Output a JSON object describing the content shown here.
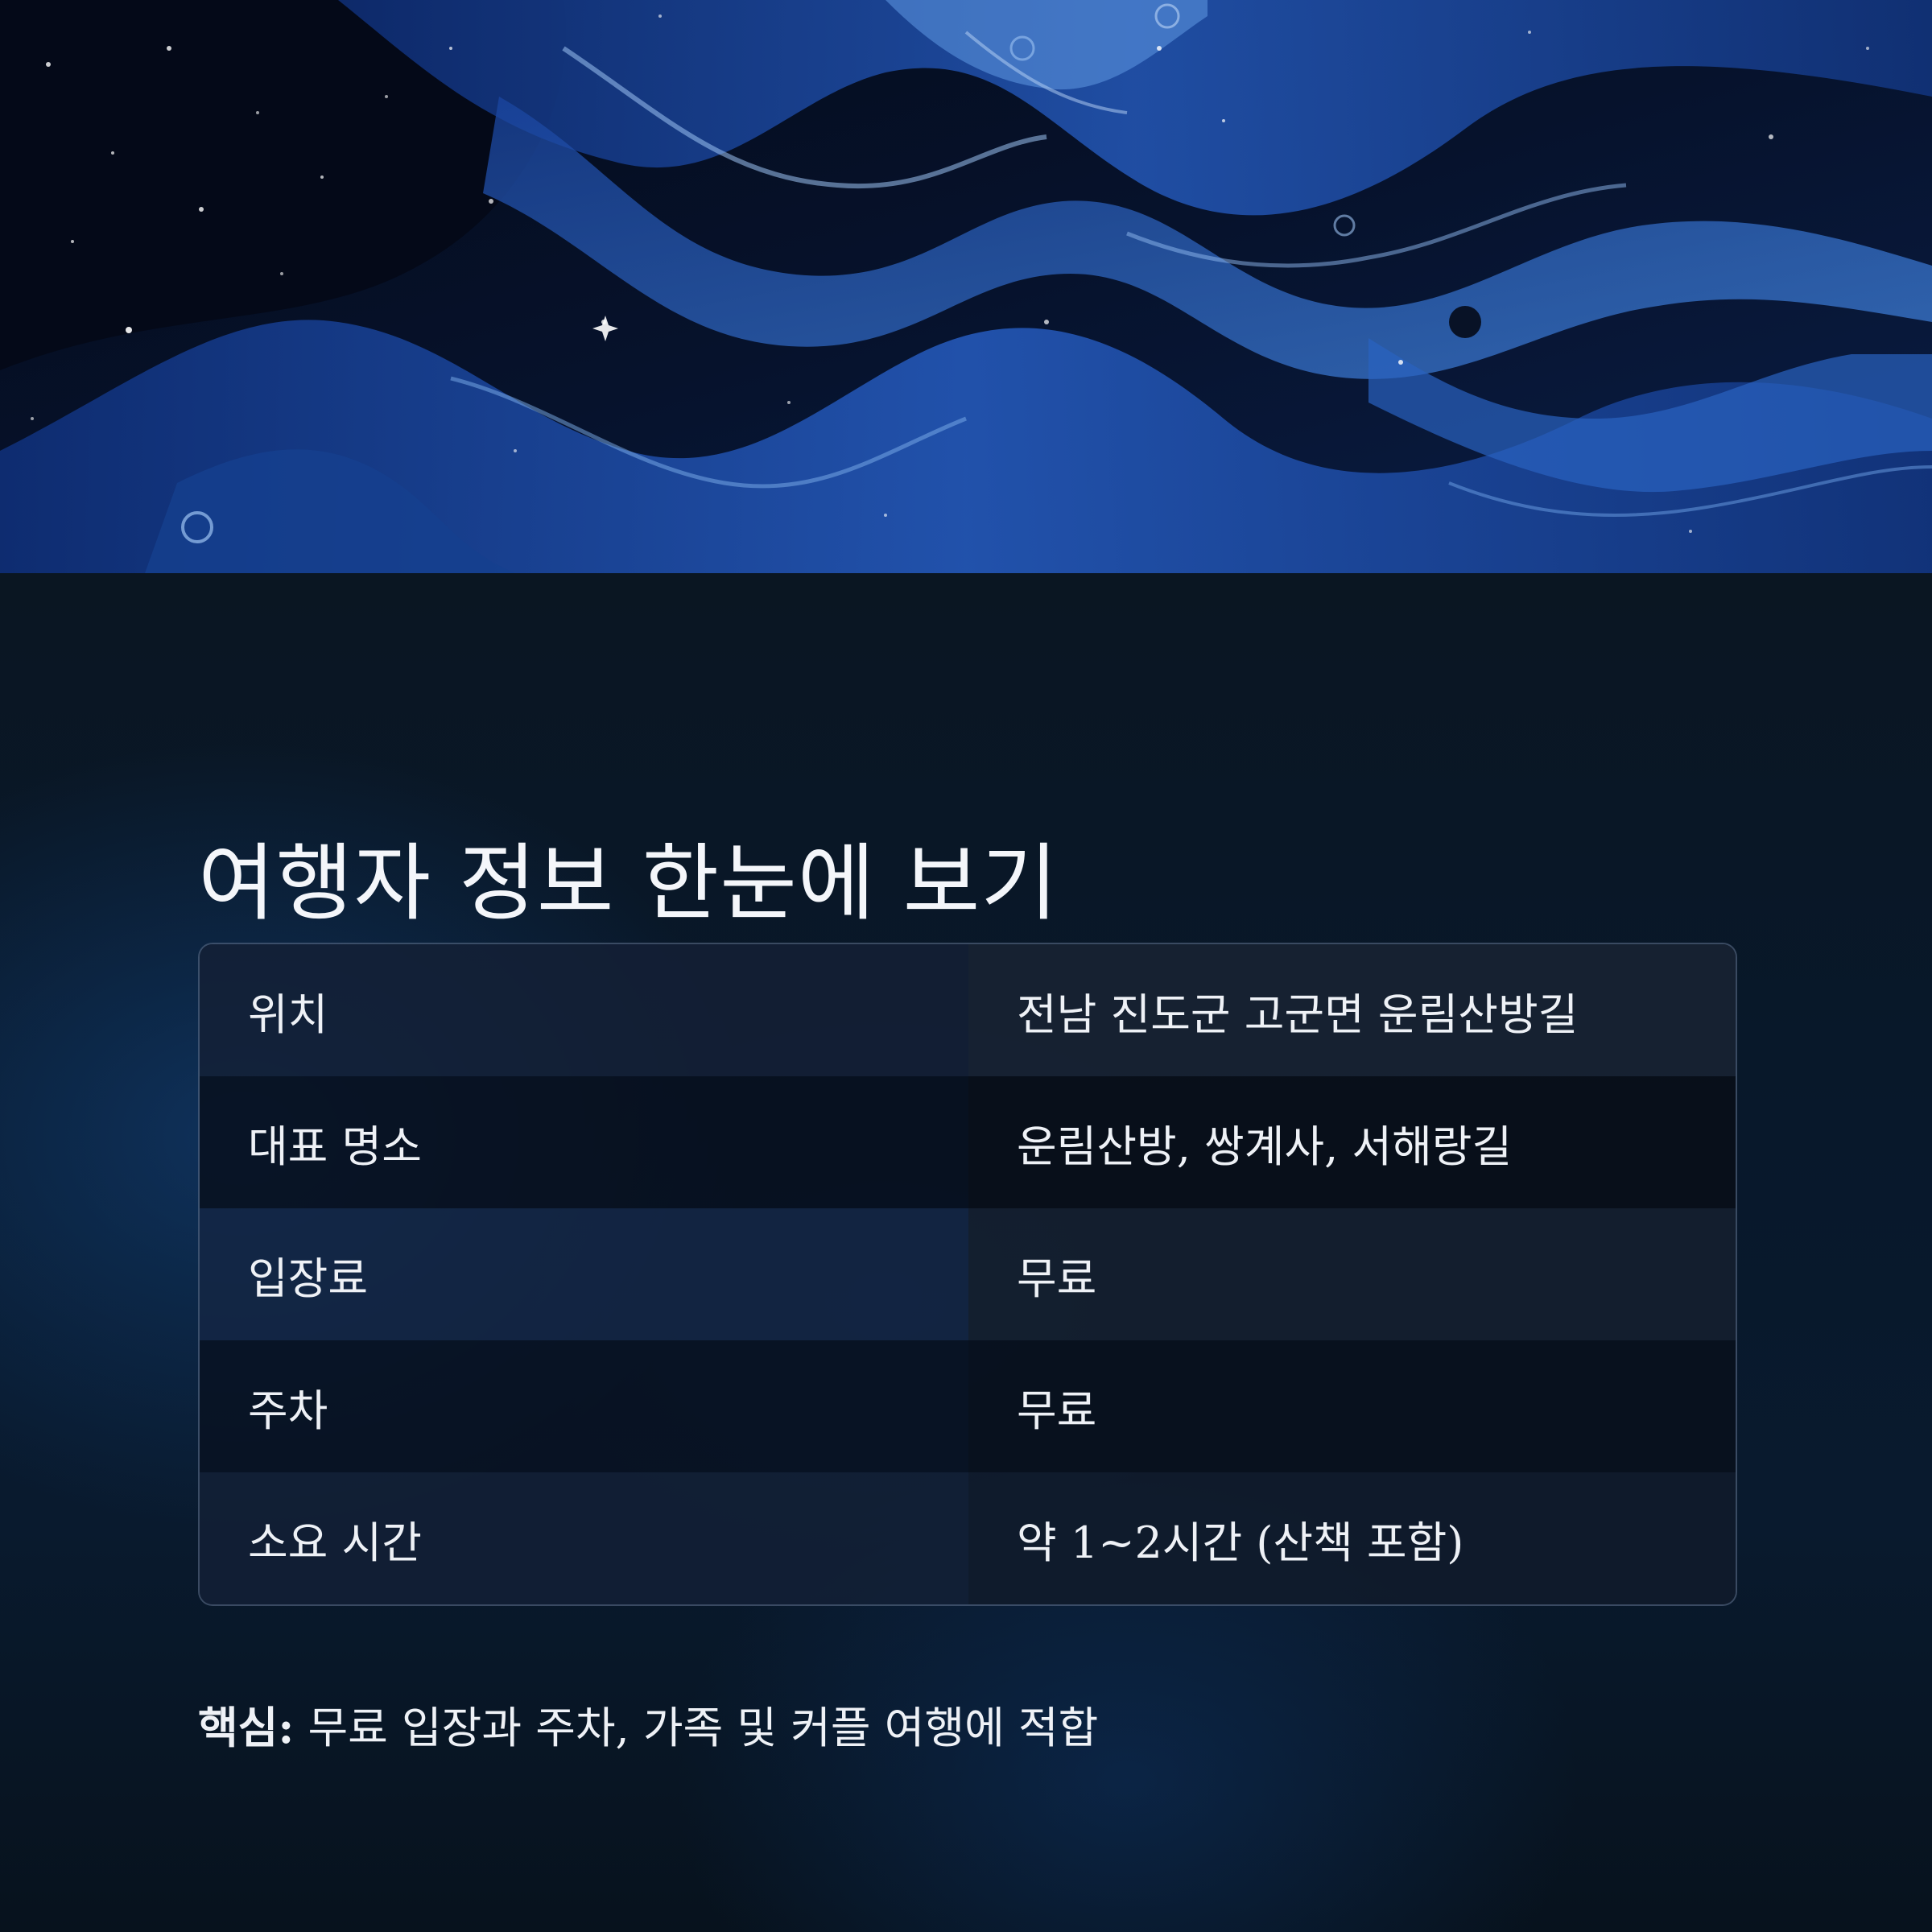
{
  "title": "여행자 정보 한눈에 보기",
  "table": {
    "rows": [
      {
        "label": "위치",
        "value": "전남 진도군 고군면 운림산방길"
      },
      {
        "label": "대표 명소",
        "value": "운림산방, 쌍계사, 서해랑길"
      },
      {
        "label": "입장료",
        "value": "무료"
      },
      {
        "label": "주차",
        "value": "무료"
      },
      {
        "label": "소요 시간",
        "value": "약 1~2시간 (산책 포함)"
      }
    ]
  },
  "summary": {
    "lead": "핵심:",
    "text": " 무료 입장과 주차, 가족 및 커플 여행에 적합"
  },
  "colors": {
    "hero_dark": "#050d1f",
    "hero_blue": "#1e4fa8",
    "hero_light": "#6fa3e6",
    "background": "#07111c",
    "text": "#eef1f6"
  }
}
